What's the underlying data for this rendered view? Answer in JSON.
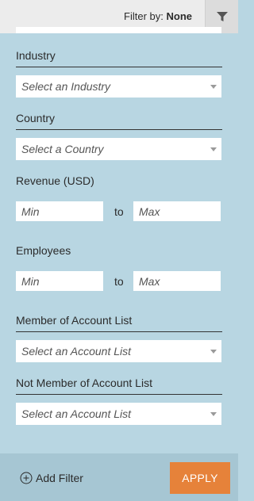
{
  "header": {
    "filter_by_label": "Filter by:",
    "filter_by_value": "None",
    "filter_icon": "funnel-icon"
  },
  "industry": {
    "label": "Industry",
    "placeholder": "Select an Industry"
  },
  "country": {
    "label": "Country",
    "placeholder": "Select a Country"
  },
  "revenue": {
    "label": "Revenue (USD)",
    "min_placeholder": "Min",
    "to_label": "to",
    "max_placeholder": "Max"
  },
  "employees": {
    "label": "Employees",
    "min_placeholder": "Min",
    "to_label": "to",
    "max_placeholder": "Max"
  },
  "member_account_list": {
    "label": "Member of Account List",
    "placeholder": "Select an Account List"
  },
  "not_member_account_list": {
    "label": "Not Member of Account List",
    "placeholder": "Select an Account List"
  },
  "footer": {
    "add_filter_label": "Add Filter",
    "add_filter_icon": "plus-circle-icon",
    "apply_label": "APPLY"
  },
  "colors": {
    "panel_background": "#b8d6e2",
    "footer_background": "#a6c6d3",
    "apply_button": "#e6823a"
  }
}
